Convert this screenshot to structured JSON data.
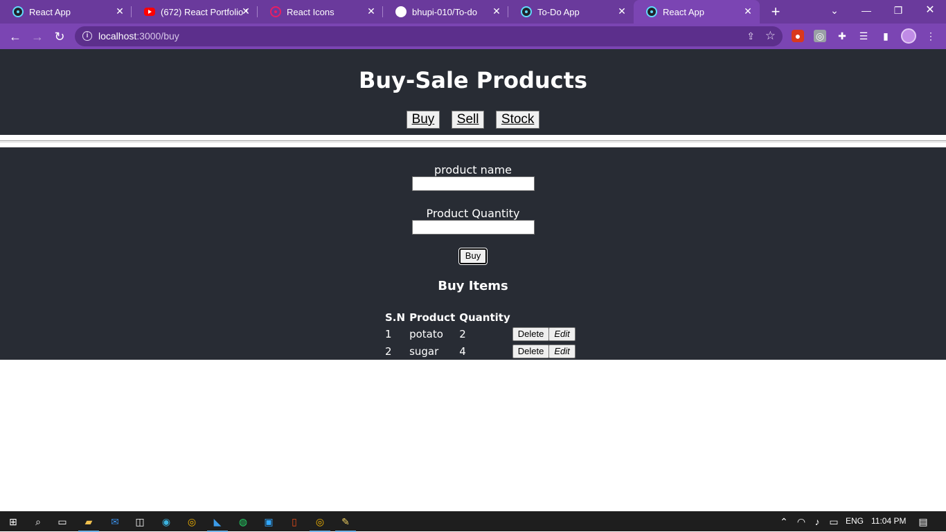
{
  "browser": {
    "tabs": [
      {
        "label": "React App",
        "icon": "react-icon"
      },
      {
        "label": "(672) React Portfolio W",
        "icon": "youtube-icon"
      },
      {
        "label": "React Icons",
        "icon": "react-icons-icon"
      },
      {
        "label": "bhupi-010/To-do",
        "icon": "github-icon"
      },
      {
        "label": "To-Do App",
        "icon": "react-icon"
      },
      {
        "label": "React App",
        "icon": "react-icon",
        "active": true
      }
    ],
    "url_host": "localhost",
    "url_path": ":3000/buy",
    "accent": "#7b45b3"
  },
  "page": {
    "title": "Buy-Sale Products",
    "nav": {
      "buy": "Buy",
      "sell": "Sell",
      "stock": "Stock"
    },
    "form": {
      "product_name_label": "product name",
      "product_name_value": "",
      "quantity_label": "Product Quantity",
      "quantity_value": "",
      "submit_label": "Buy"
    },
    "items_title": "Buy Items",
    "table": {
      "headers": [
        "S.N",
        "Product",
        "Quantity"
      ],
      "rows": [
        {
          "sn": "1",
          "product": "potato",
          "quantity": "2",
          "delete": "Delete",
          "edit": "Edit"
        },
        {
          "sn": "2",
          "product": "sugar",
          "quantity": "4",
          "delete": "Delete",
          "edit": "Edit"
        }
      ]
    },
    "background": "#282c34"
  },
  "taskbar": {
    "language": "ENG",
    "time": "11:04 PM"
  }
}
